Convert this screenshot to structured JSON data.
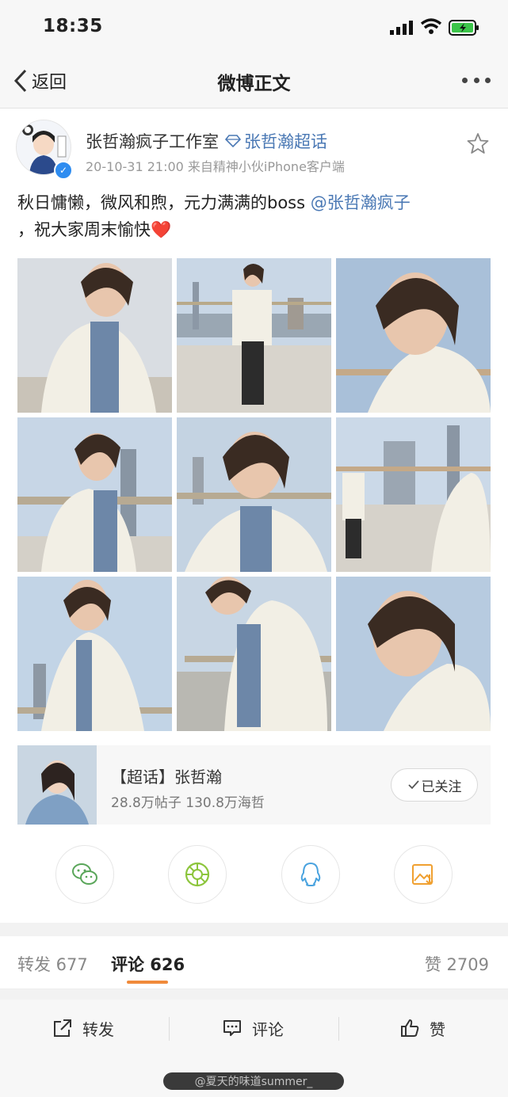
{
  "status": {
    "time": "18:35"
  },
  "nav": {
    "back": "返回",
    "title": "微博正文"
  },
  "post": {
    "author": "张哲瀚疯子工作室",
    "topic_tag": "张哲瀚超话",
    "meta": "20-10-31 21:00  来自精神小伙iPhone客户端",
    "text_main": "秋日慵懒，微风和煦，元力满满的boss ",
    "mention": "@张哲瀚疯子",
    "text_tail": "，祝大家周末愉快",
    "emoji": "❤️"
  },
  "topic_card": {
    "name": "【超话】张哲瀚",
    "stats": "28.8万帖子 130.8万海哲",
    "follow": "已关注"
  },
  "share": [
    "wechat-icon",
    "moments-icon",
    "qq-icon",
    "save-image-icon"
  ],
  "tabs": {
    "repost": "转发 677",
    "comment": "评论 626",
    "like": "赞 2709"
  },
  "actions": {
    "repost": "转发",
    "comment": "评论",
    "like": "赞"
  },
  "watermark": "@夏天的味道summer_",
  "colors": {
    "link": "#4a78b4",
    "accent": "#f08a3a"
  }
}
